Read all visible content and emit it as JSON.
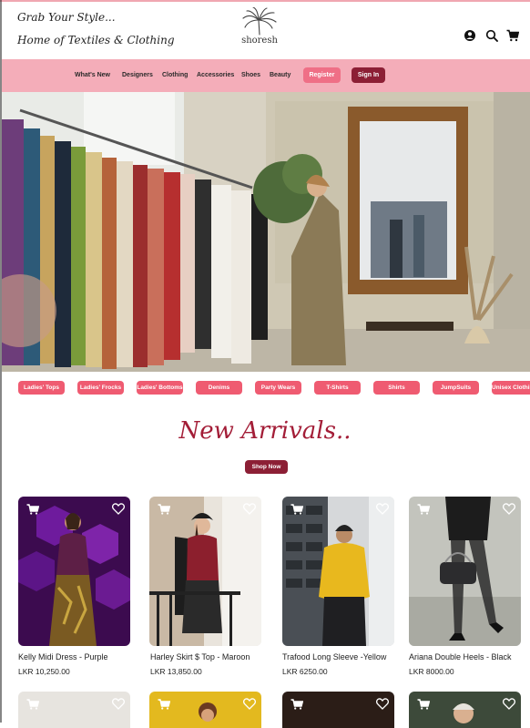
{
  "header": {
    "tagline_1": "Grab Your Style...",
    "tagline_2": "Home of Textiles & Clothing",
    "logo_text": "shoresh"
  },
  "nav": {
    "links": [
      "What's New",
      "Designers",
      "Clothing",
      "Accessories",
      "Shoes",
      "Beauty"
    ],
    "register_label": "Register",
    "signin_label": "Sign In"
  },
  "categories": [
    "Ladies' Tops",
    "Ladies' Frocks",
    "Ladies' Bottoms",
    "Denims",
    "Party Wears",
    "T-Shirts",
    "Shirts",
    "JumpSuits",
    "Unisex Clothing"
  ],
  "section": {
    "title": "New Arrivals..",
    "shop_now_label": "Shop Now"
  },
  "products": [
    {
      "name": "Kelly Midi Dress - Purple",
      "price": "LKR 10,250.00"
    },
    {
      "name": "Harley Skirt $ Top - Maroon",
      "price": "LKR 13,850.00"
    },
    {
      "name": "Trafood Long Sleeve -Yellow",
      "price": "LKR 6250.00"
    },
    {
      "name": "Ariana Double Heels - Black",
      "price": "LKR 8000.00"
    }
  ],
  "icons": [
    "account-icon",
    "search-icon",
    "cart-icon",
    "add-to-cart-icon",
    "wishlist-heart-icon"
  ],
  "colors": {
    "nav_pink": "#f4adb9",
    "accent_pink": "#ef5b71",
    "maroon": "#8c1f35",
    "title_red": "#a31d37"
  }
}
